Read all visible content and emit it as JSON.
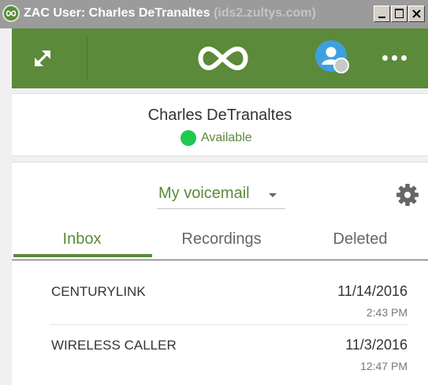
{
  "window": {
    "title": "ZAC User: Charles DeTranaltes",
    "title_server": "(ids2.zultys.com)"
  },
  "header": {
    "expand_icon": "expand-arrows-icon",
    "logo_icon": "zultys-infinity-logo",
    "avatar_icon": "user-avatar-icon",
    "more_icon": "more-dots-icon",
    "brand_color": "#5b8a3a"
  },
  "user": {
    "name": "Charles DeTranaltes",
    "status": "Available",
    "status_color": "#1dc94e"
  },
  "voicemail": {
    "mailbox_select": "My voicemail",
    "settings_icon": "gear-icon",
    "tabs": [
      {
        "label": "Inbox",
        "active": true
      },
      {
        "label": "Recordings",
        "active": false
      },
      {
        "label": "Deleted",
        "active": false
      }
    ],
    "messages": [
      {
        "caller": "CENTURYLINK",
        "date": "11/14/2016",
        "time": "2:43 PM"
      },
      {
        "caller": "WIRELESS CALLER",
        "date": "11/3/2016",
        "time": "12:47 PM"
      }
    ]
  }
}
